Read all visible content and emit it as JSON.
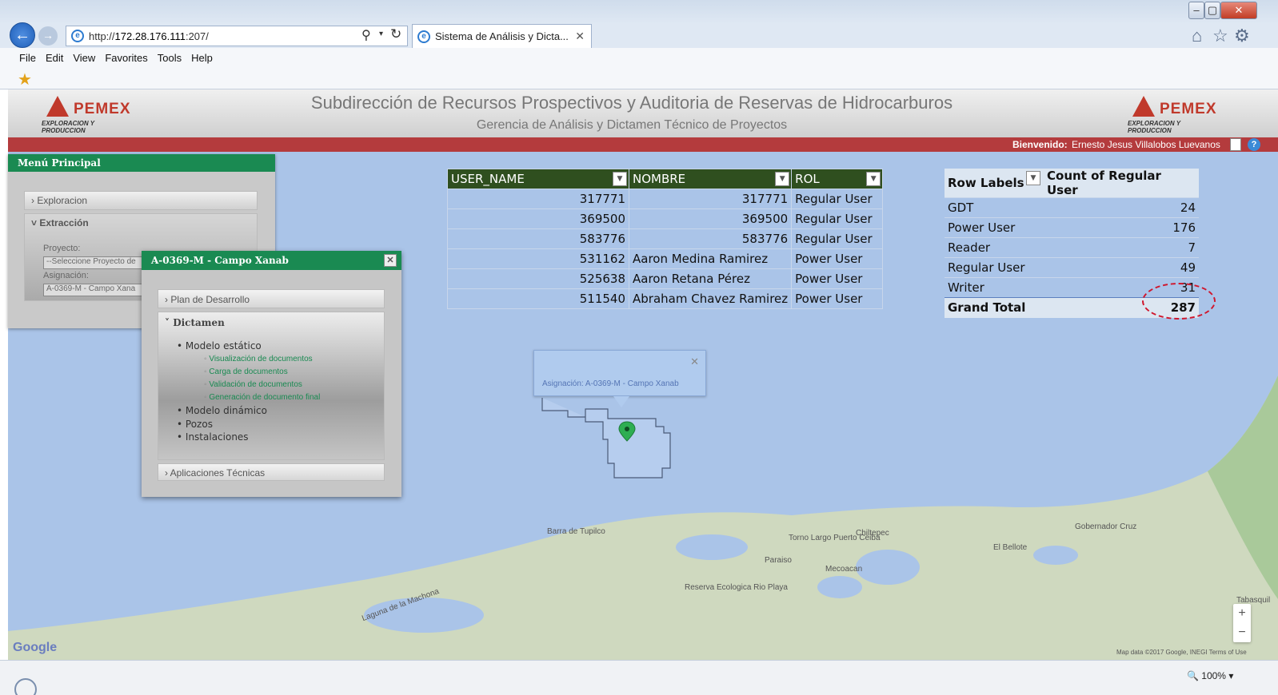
{
  "browser": {
    "url_prefix": "http://",
    "url_host": "172.28.176.111",
    "url_path": ":207/",
    "tab_title": "Sistema de Análisis y Dicta...",
    "menu": [
      "File",
      "Edit",
      "View",
      "Favorites",
      "Tools",
      "Help"
    ],
    "zoom": "100%"
  },
  "header": {
    "logo_word": "PEMEX",
    "logo_sub": "EXPLORACION Y PRODUCCION",
    "title": "Subdirección de Recursos Prospectivos y Auditoria de Reservas de Hidrocarburos",
    "subtitle": "Gerencia de Análisis y Dictamen Técnico de Proyectos",
    "welcome_label": "Bienvenido:",
    "welcome_user": "Ernesto Jesus Villalobos Luevanos"
  },
  "sidebar": {
    "title": "Menú Principal",
    "items": [
      "Exploracion",
      "Extracción"
    ],
    "proyecto_label": "Proyecto:",
    "proyecto_value": "--Seleccione Proyecto de",
    "asignacion_label": "Asignación:",
    "asignacion_value": "A-0369-M - Campo Xana"
  },
  "dialog": {
    "title": "A-0369-M - Campo Xanab",
    "plan": "Plan de Desarrollo",
    "dictamen": "Dictamen",
    "modelo_estatico": "Modelo estático",
    "sub": [
      "Visualización de documentos",
      "Carga de documentos",
      "Validación de documentos",
      "Generación de documento final"
    ],
    "modelo_dinamico": "Modelo dinámico",
    "pozos": "Pozos",
    "instalaciones": "Instalaciones",
    "aplicaciones": "Aplicaciones Técnicas"
  },
  "user_table": {
    "headers": [
      "USER_NAME",
      "NOMBRE",
      "ROL"
    ],
    "rows": [
      [
        "317771",
        "317771",
        "Regular User"
      ],
      [
        "369500",
        "369500",
        "Regular User"
      ],
      [
        "583776",
        "583776",
        "Regular User"
      ],
      [
        "531162",
        "Aaron Medina Ramirez",
        "Power User"
      ],
      [
        "525638",
        "Aaron Retana Pérez",
        "Power User"
      ],
      [
        "511540",
        "Abraham Chavez Ramirez",
        "Power User"
      ]
    ]
  },
  "pivot": {
    "headers": [
      "Row Labels",
      "Count of Regular User"
    ],
    "rows": [
      [
        "GDT",
        "24"
      ],
      [
        "Power User",
        "176"
      ],
      [
        "Reader",
        "7"
      ],
      [
        "Regular User",
        "49"
      ],
      [
        "Writer",
        "31"
      ]
    ],
    "total_label": "Grand Total",
    "total_value": "287"
  },
  "map": {
    "popup_text": "Asignación: A-0369-M - Campo Xanab",
    "places": [
      "Barra de Tupilco",
      "Torno Largo Puerto Ceiba",
      "Chiltepec",
      "Paraiso",
      "Mecoacan",
      "Reserva Ecologica Rio Playa",
      "Laguna de la Machona",
      "El Bellote",
      "Gobernador Cruz",
      "Tabasquil"
    ],
    "google": "Google",
    "credit": "Map data ©2017 Google, INEGI   Terms of Use"
  }
}
